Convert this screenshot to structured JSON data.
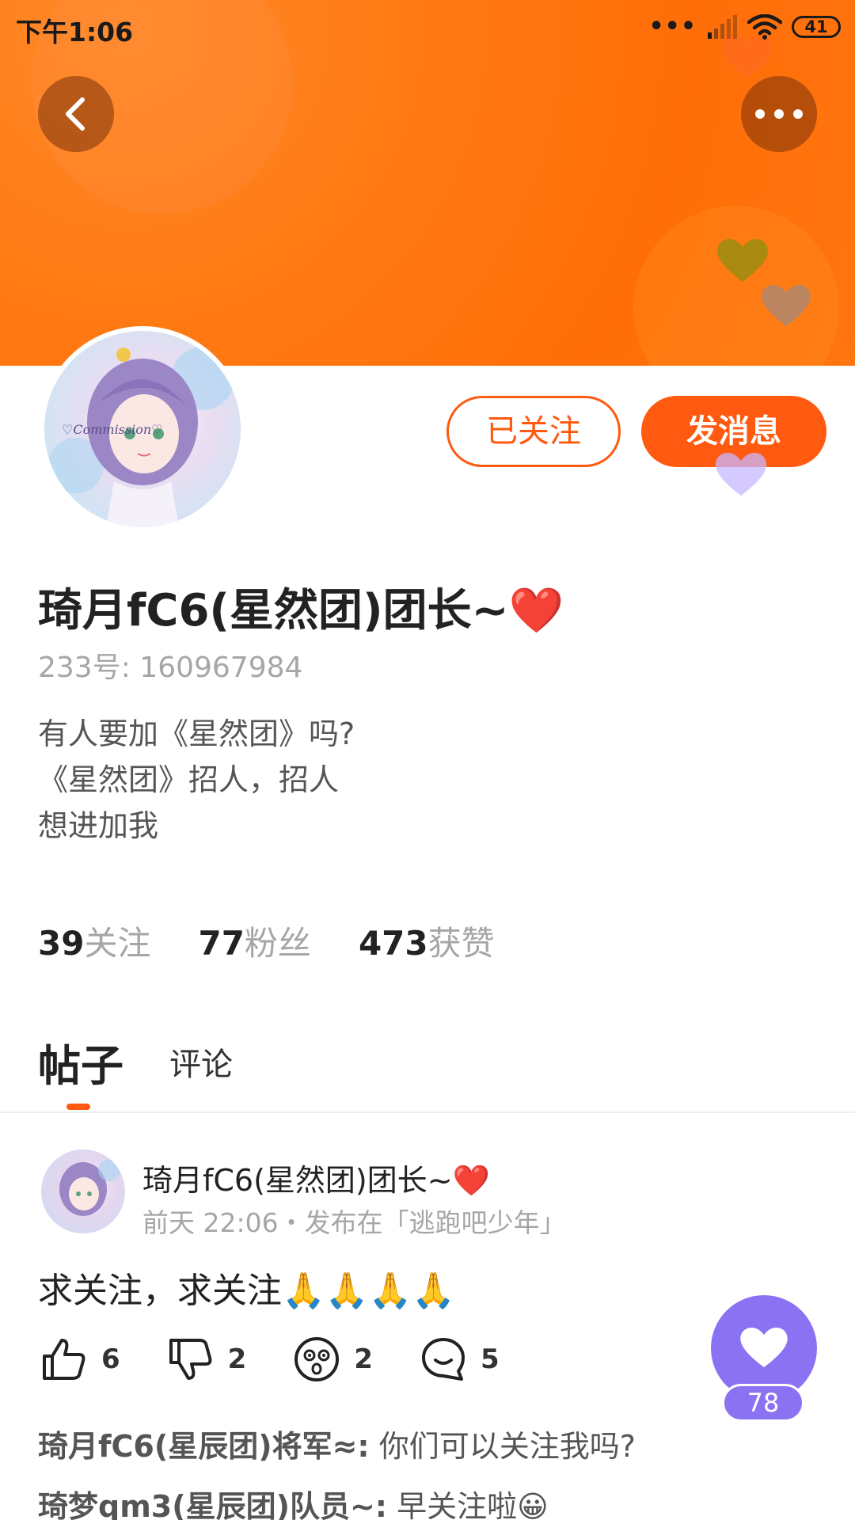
{
  "status_bar": {
    "time": "下午1:06",
    "dots": "•••",
    "battery": "41"
  },
  "header": {
    "icons": [
      "back-arrow-icon",
      "more-dots-icon",
      "heart-icon"
    ],
    "banner_color": "#ff7510"
  },
  "profile": {
    "name": "琦月fC6(星然团)团长~❤️",
    "id_text": "233号: 160967984",
    "bio": [
      "有人要加《星然团》吗?",
      "《星然团》招人，招人",
      "想进加我"
    ],
    "follow_button": "已关注",
    "message_button": "发消息",
    "stats": [
      {
        "value": "39",
        "label": "关注"
      },
      {
        "value": "77",
        "label": "粉丝"
      },
      {
        "value": "473",
        "label": "获赞"
      }
    ]
  },
  "tabs": [
    {
      "label": "帖子",
      "active": true
    },
    {
      "label": "评论",
      "active": false
    }
  ],
  "post": {
    "author": "琦月fC6(星然团)团长~❤️",
    "meta": "前天 22:06・发布在「逃跑吧少年」",
    "text": "求关注，求关注🙏🙏🙏🙏",
    "actions": [
      {
        "icon": "thumbs-up-icon",
        "count": "6"
      },
      {
        "icon": "thumbs-down-icon",
        "count": "2"
      },
      {
        "icon": "dizzy-face-icon",
        "count": "2"
      },
      {
        "icon": "comment-bubble-icon",
        "count": "5"
      }
    ],
    "replies": [
      {
        "author": "琦月fC6(星辰团)将军≈:",
        "text": " 你们可以关注我吗?"
      },
      {
        "author": "琦梦qm3(星辰团)队员~:",
        "text": " 早关注啦😀"
      }
    ]
  },
  "floating_like": {
    "icon": "heart-icon",
    "count": "78",
    "color": "#8b72f2"
  },
  "colors": {
    "accent": "#ff5a10",
    "muted_text": "#a6a6a6"
  }
}
